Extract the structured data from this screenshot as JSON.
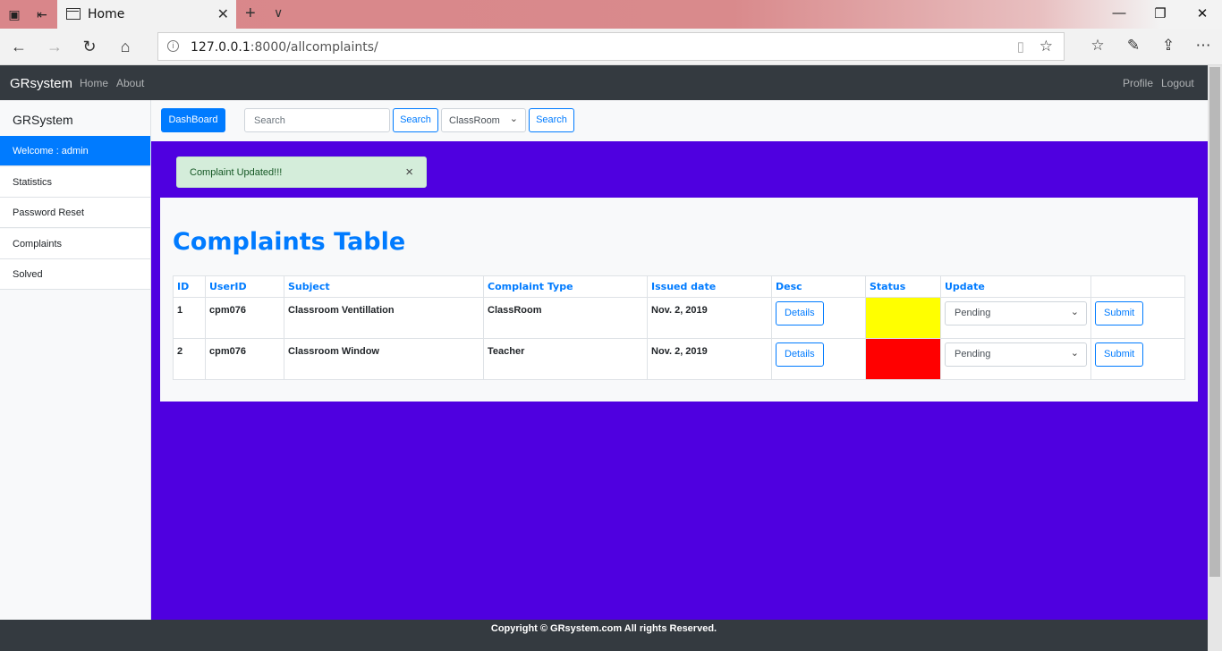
{
  "browser": {
    "tab_title": "Home",
    "url_host": "127.0.0.1",
    "url_rest": ":8000/allcomplaints/"
  },
  "navbar": {
    "brand": "GRsystem",
    "links": [
      "Home",
      "About"
    ],
    "right_links": [
      "Profile",
      "Logout"
    ]
  },
  "sidebar": {
    "title": "GRSystem",
    "items": [
      {
        "label": "Welcome : admin",
        "active": true
      },
      {
        "label": "Statistics"
      },
      {
        "label": "Password Reset"
      },
      {
        "label": "Complaints"
      },
      {
        "label": "Solved"
      }
    ]
  },
  "toolbar": {
    "dashboard_label": "DashBoard",
    "search_placeholder": "Search",
    "search_label": "Search",
    "filter_value": "ClassRoom",
    "filter_search_label": "Search"
  },
  "alert": {
    "message": "Complaint Updated!!!",
    "close": "×"
  },
  "table": {
    "title": "Complaints Table",
    "headers": [
      "ID",
      "UserID",
      "Subject",
      "Complaint Type",
      "Issued date",
      "Desc",
      "Status",
      "Update",
      ""
    ],
    "rows": [
      {
        "id": "1",
        "user": "cpm076",
        "subject": "Classroom Ventillation",
        "type": "ClassRoom",
        "date": "Nov. 2, 2019",
        "desc_btn": "Details",
        "status_color": "#ffff00",
        "update_value": "Pending",
        "submit": "Submit"
      },
      {
        "id": "2",
        "user": "cpm076",
        "subject": "Classroom Window",
        "type": "Teacher",
        "date": "Nov. 2, 2019",
        "desc_btn": "Details",
        "status_color": "#ff0000",
        "update_value": "Pending",
        "submit": "Submit"
      }
    ]
  },
  "footer": {
    "text": "Copyright © GRsystem.com All rights Reserved."
  },
  "colors": {
    "primary": "#007bff",
    "main_bg": "#4f00e0",
    "navbar": "#343a40",
    "alert_bg": "#d4edda"
  }
}
